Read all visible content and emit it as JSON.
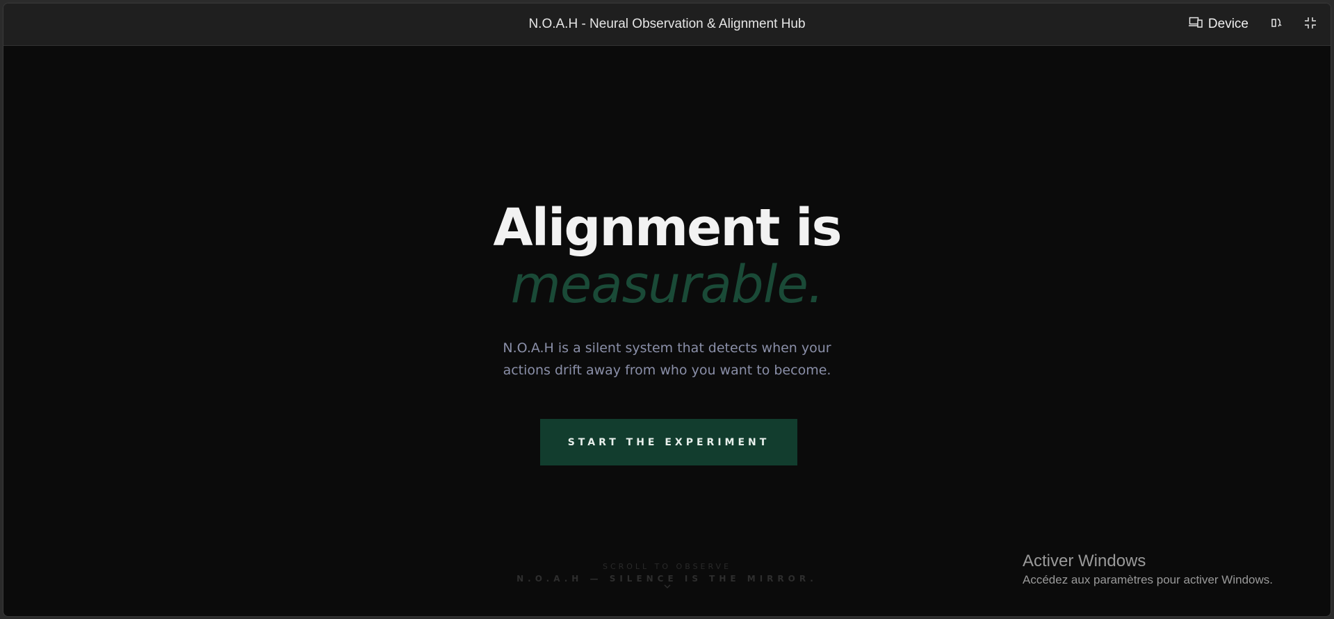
{
  "window": {
    "title": "N.O.A.H - Neural Observation & Alignment Hub",
    "device_label": "Device",
    "icons": [
      "device-icon",
      "rotate-icon",
      "fullscreen-exit-icon"
    ]
  },
  "hero": {
    "headline": "Alignment is",
    "headline_accent": "measurable.",
    "subtext_line1": "N.O.A.H is a silent system that detects when your",
    "subtext_line2": "actions drift away from who you want to become.",
    "cta_label": "START THE EXPERIMENT",
    "scroll_hint": "SCROLL TO OBSERVE",
    "footer_tagline": "N.O.A.H — SILENCE IS THE MIRROR."
  },
  "windows_activation": {
    "title": "Activer Windows",
    "subtitle": "Accédez aux paramètres pour activer Windows."
  },
  "colors": {
    "background": "#0b0b0b",
    "titlebar": "#1f1f1f",
    "accent_green": "#123d2e",
    "accent_text": "#1a4a37",
    "subtext": "#8a8fa8"
  }
}
